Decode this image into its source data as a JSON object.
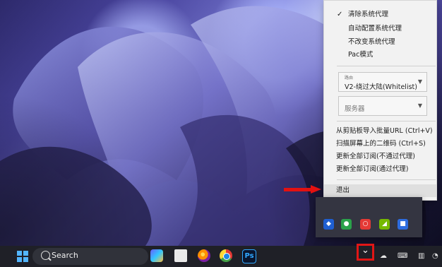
{
  "menu": {
    "items": [
      {
        "label": "清除系统代理",
        "checked": true
      },
      {
        "label": "自动配置系统代理",
        "checked": false
      },
      {
        "label": "不改变系统代理",
        "checked": false
      },
      {
        "label": "Pac模式",
        "checked": false
      }
    ],
    "route_select": {
      "label": "路由",
      "value": "V2-绕过大陆(Whitelist)"
    },
    "server_select": {
      "placeholder": "服务器"
    },
    "actions": [
      {
        "label": "从剪贴板导入批量URL (Ctrl+V)"
      },
      {
        "label": "扫描屏幕上的二维码 (Ctrl+S)"
      },
      {
        "label": "更新全部订阅(不通过代理)"
      },
      {
        "label": "更新全部订阅(通过代理)"
      }
    ],
    "exit_label": "退出"
  },
  "taskbar": {
    "search_label": "Search",
    "icons": [
      "windows-start-icon",
      "search-icon",
      "copilot-icon",
      "file-explorer-icon",
      "firefox-icon",
      "chrome-icon",
      "photoshop-icon",
      "chevron-up-icon",
      "cloud-icon",
      "keyboard-icon",
      "network-icon",
      "wifi-icon"
    ]
  },
  "tray": {
    "icons": [
      "tray-shield-icon",
      "tray-green-icon",
      "tray-red-icon",
      "tray-nvidia-icon",
      "tray-blue-icon"
    ]
  },
  "colors": {
    "highlight_red": "#e31111",
    "menu_background": "#f2f2f2",
    "taskbar_background": "#1f2027",
    "tray_background": "#343541"
  }
}
